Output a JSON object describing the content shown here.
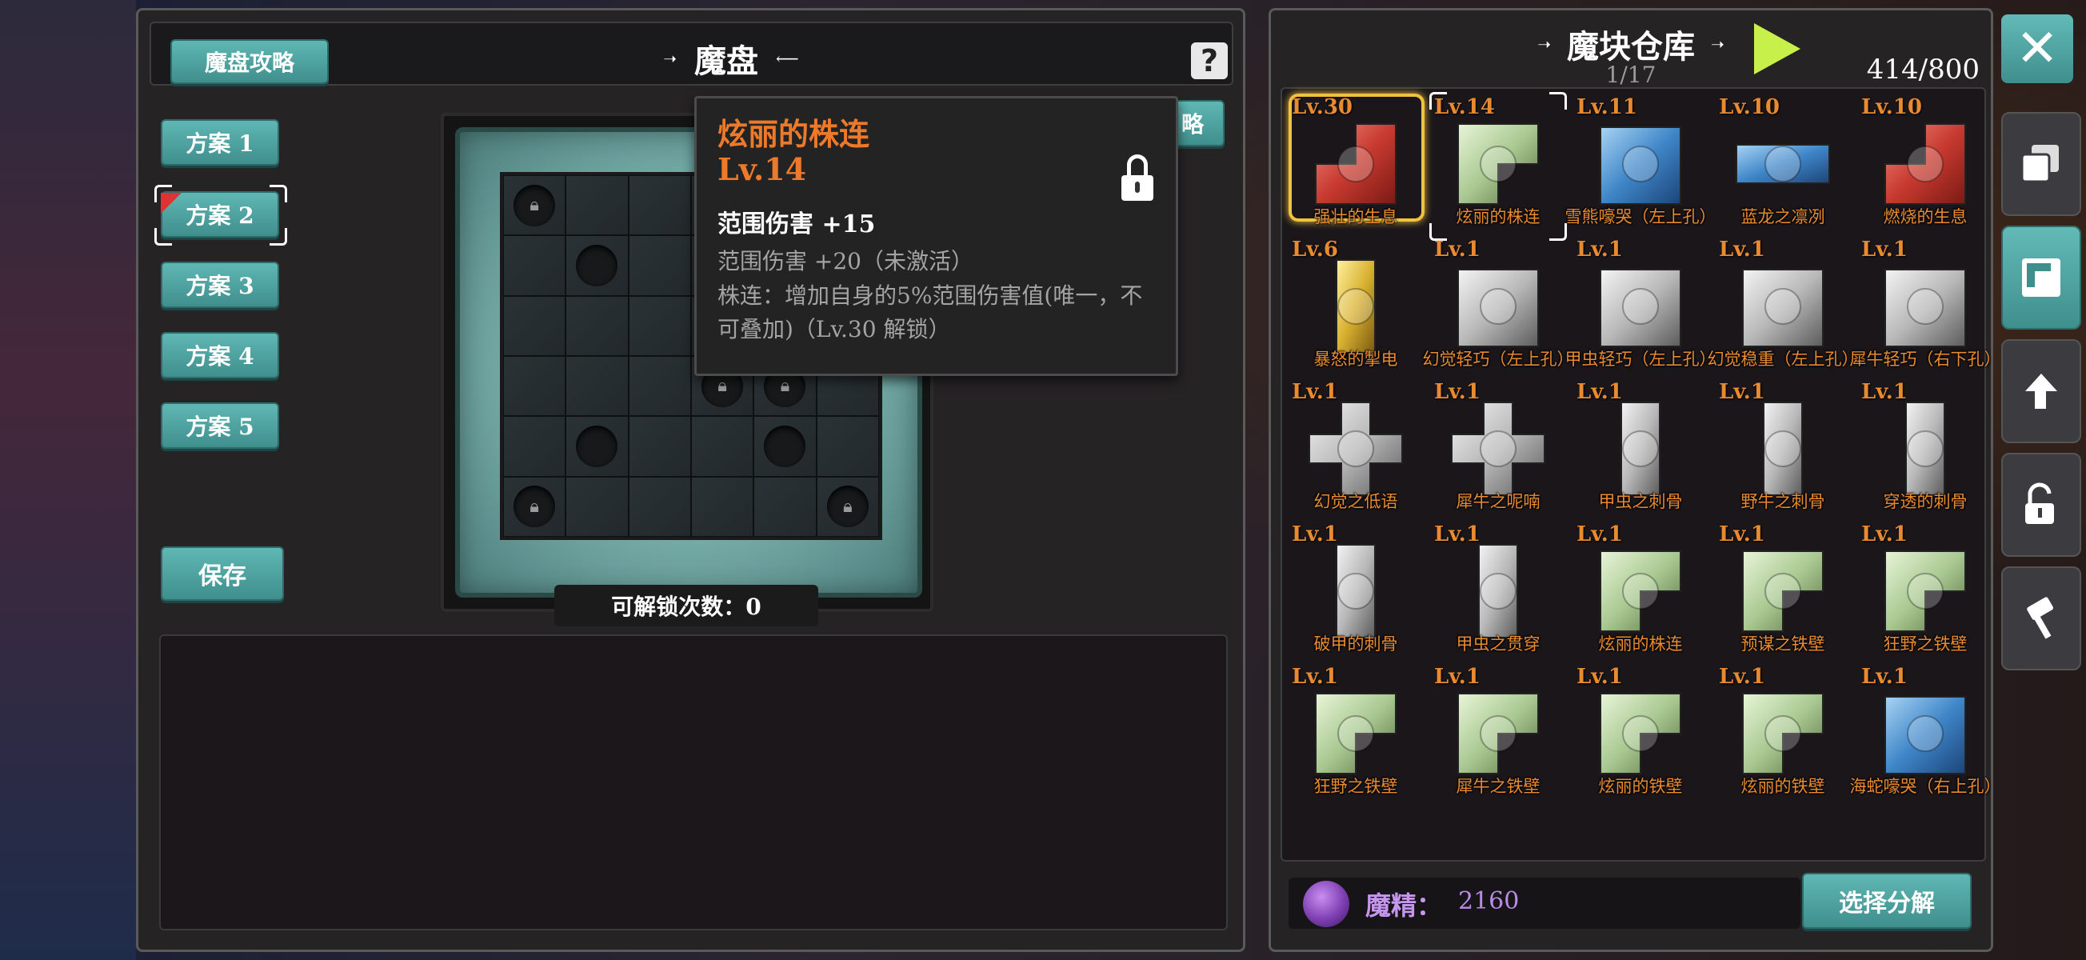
{
  "left": {
    "guide_label": "魔盘攻略",
    "title": "魔盘",
    "help_glyph": "?",
    "plans": [
      "方案 1",
      "方案 2",
      "方案 3",
      "方案 4",
      "方案 5"
    ],
    "selected_plan_index": 1,
    "save_label": "保存",
    "unlock_count_label": "可解锁次数：0",
    "partial_button_label": "略"
  },
  "board": {
    "rows": 6,
    "cols": 6,
    "cells": [
      "lock",
      "",
      "",
      "",
      "",
      "",
      "",
      "slot",
      "",
      "",
      "",
      "",
      "",
      "",
      "",
      "lock",
      "",
      "",
      "",
      "",
      "",
      "lock",
      "lock",
      "",
      "",
      "slot",
      "",
      "",
      "slot",
      "",
      "lock",
      "",
      "",
      "",
      "",
      "lock"
    ]
  },
  "tooltip": {
    "name": "炫丽的株连",
    "level": "Lv.14",
    "attr_active": "范围伤害 +15",
    "attr_inactive": "范围伤害 +20（未激活）",
    "effect": "株连：增加自身的5%范围伤害值(唯一，不可叠加)（Lv.30 解锁）",
    "locked": true,
    "name_color": "#ec7a2a"
  },
  "warehouse": {
    "title": "魔块仓库",
    "page": "1/17",
    "capacity": "414/800",
    "items": [
      {
        "level": "Lv.30",
        "name": "强壮的生息",
        "color": "red",
        "shape": "L-corner",
        "selected": "gold"
      },
      {
        "level": "Lv.14",
        "name": "炫丽的株连",
        "color": "green",
        "shape": "L-top",
        "selected": "bracket"
      },
      {
        "level": "Lv.11",
        "name": "雪熊嚎哭（左上孔）",
        "color": "blue",
        "shape": "square"
      },
      {
        "level": "Lv.10",
        "name": "蓝龙之凛冽",
        "color": "blue",
        "shape": "bar-h"
      },
      {
        "level": "Lv.10",
        "name": "燃烧的生息",
        "color": "red",
        "shape": "L-corner"
      },
      {
        "level": "Lv.6",
        "name": "暴怒的掣电",
        "color": "gold",
        "shape": "bar-v"
      },
      {
        "level": "Lv.1",
        "name": "幻觉轻巧（左上孔）",
        "color": "gray",
        "shape": "square"
      },
      {
        "level": "Lv.1",
        "name": "甲虫轻巧（左上孔）",
        "color": "gray",
        "shape": "square"
      },
      {
        "level": "Lv.1",
        "name": "幻觉稳重（左上孔）",
        "color": "gray",
        "shape": "square"
      },
      {
        "level": "Lv.1",
        "name": "犀牛轻巧（右下孔）",
        "color": "gray",
        "shape": "square"
      },
      {
        "level": "Lv.1",
        "name": "幻觉之低语",
        "color": "gray",
        "shape": "cross"
      },
      {
        "level": "Lv.1",
        "name": "犀牛之呢喃",
        "color": "gray",
        "shape": "cross"
      },
      {
        "level": "Lv.1",
        "name": "甲虫之刺骨",
        "color": "gray",
        "shape": "bar-v"
      },
      {
        "level": "Lv.1",
        "name": "野牛之刺骨",
        "color": "gray",
        "shape": "bar-v"
      },
      {
        "level": "Lv.1",
        "name": "穿透的刺骨",
        "color": "gray",
        "shape": "bar-v"
      },
      {
        "level": "Lv.1",
        "name": "破甲的刺骨",
        "color": "gray",
        "shape": "bar-v"
      },
      {
        "level": "Lv.1",
        "name": "甲虫之贯穿",
        "color": "gray",
        "shape": "bar-v"
      },
      {
        "level": "Lv.1",
        "name": "炫丽的株连",
        "color": "green",
        "shape": "L-top"
      },
      {
        "level": "Lv.1",
        "name": "预谋之铁壁",
        "color": "green",
        "shape": "L-top"
      },
      {
        "level": "Lv.1",
        "name": "狂野之铁壁",
        "color": "green",
        "shape": "L-top"
      },
      {
        "level": "Lv.1",
        "name": "狂野之铁壁",
        "color": "green",
        "shape": "L-top"
      },
      {
        "level": "Lv.1",
        "name": "犀牛之铁壁",
        "color": "green",
        "shape": "L-top"
      },
      {
        "level": "Lv.1",
        "name": "炫丽的铁壁",
        "color": "green",
        "shape": "L-top"
      },
      {
        "level": "Lv.1",
        "name": "炫丽的铁壁",
        "color": "green",
        "shape": "L-top"
      },
      {
        "level": "Lv.1",
        "name": "海蛇嚎哭（右上孔）",
        "color": "blue",
        "shape": "square"
      }
    ],
    "essence_label": "魔精：",
    "essence_value": "2160",
    "decompose_label": "选择分解"
  },
  "sidebar": {
    "close_glyph": "✕",
    "buttons": [
      "copy-icon",
      "frame-icon",
      "return-icon",
      "unlock-icon",
      "hammer-icon"
    ],
    "active_index": 1
  },
  "colors": {
    "accent_teal": "#4fa3a0",
    "level_orange": "#e88a30",
    "play_green": "#c8f04a",
    "essence_purple": "#b98ae8"
  }
}
